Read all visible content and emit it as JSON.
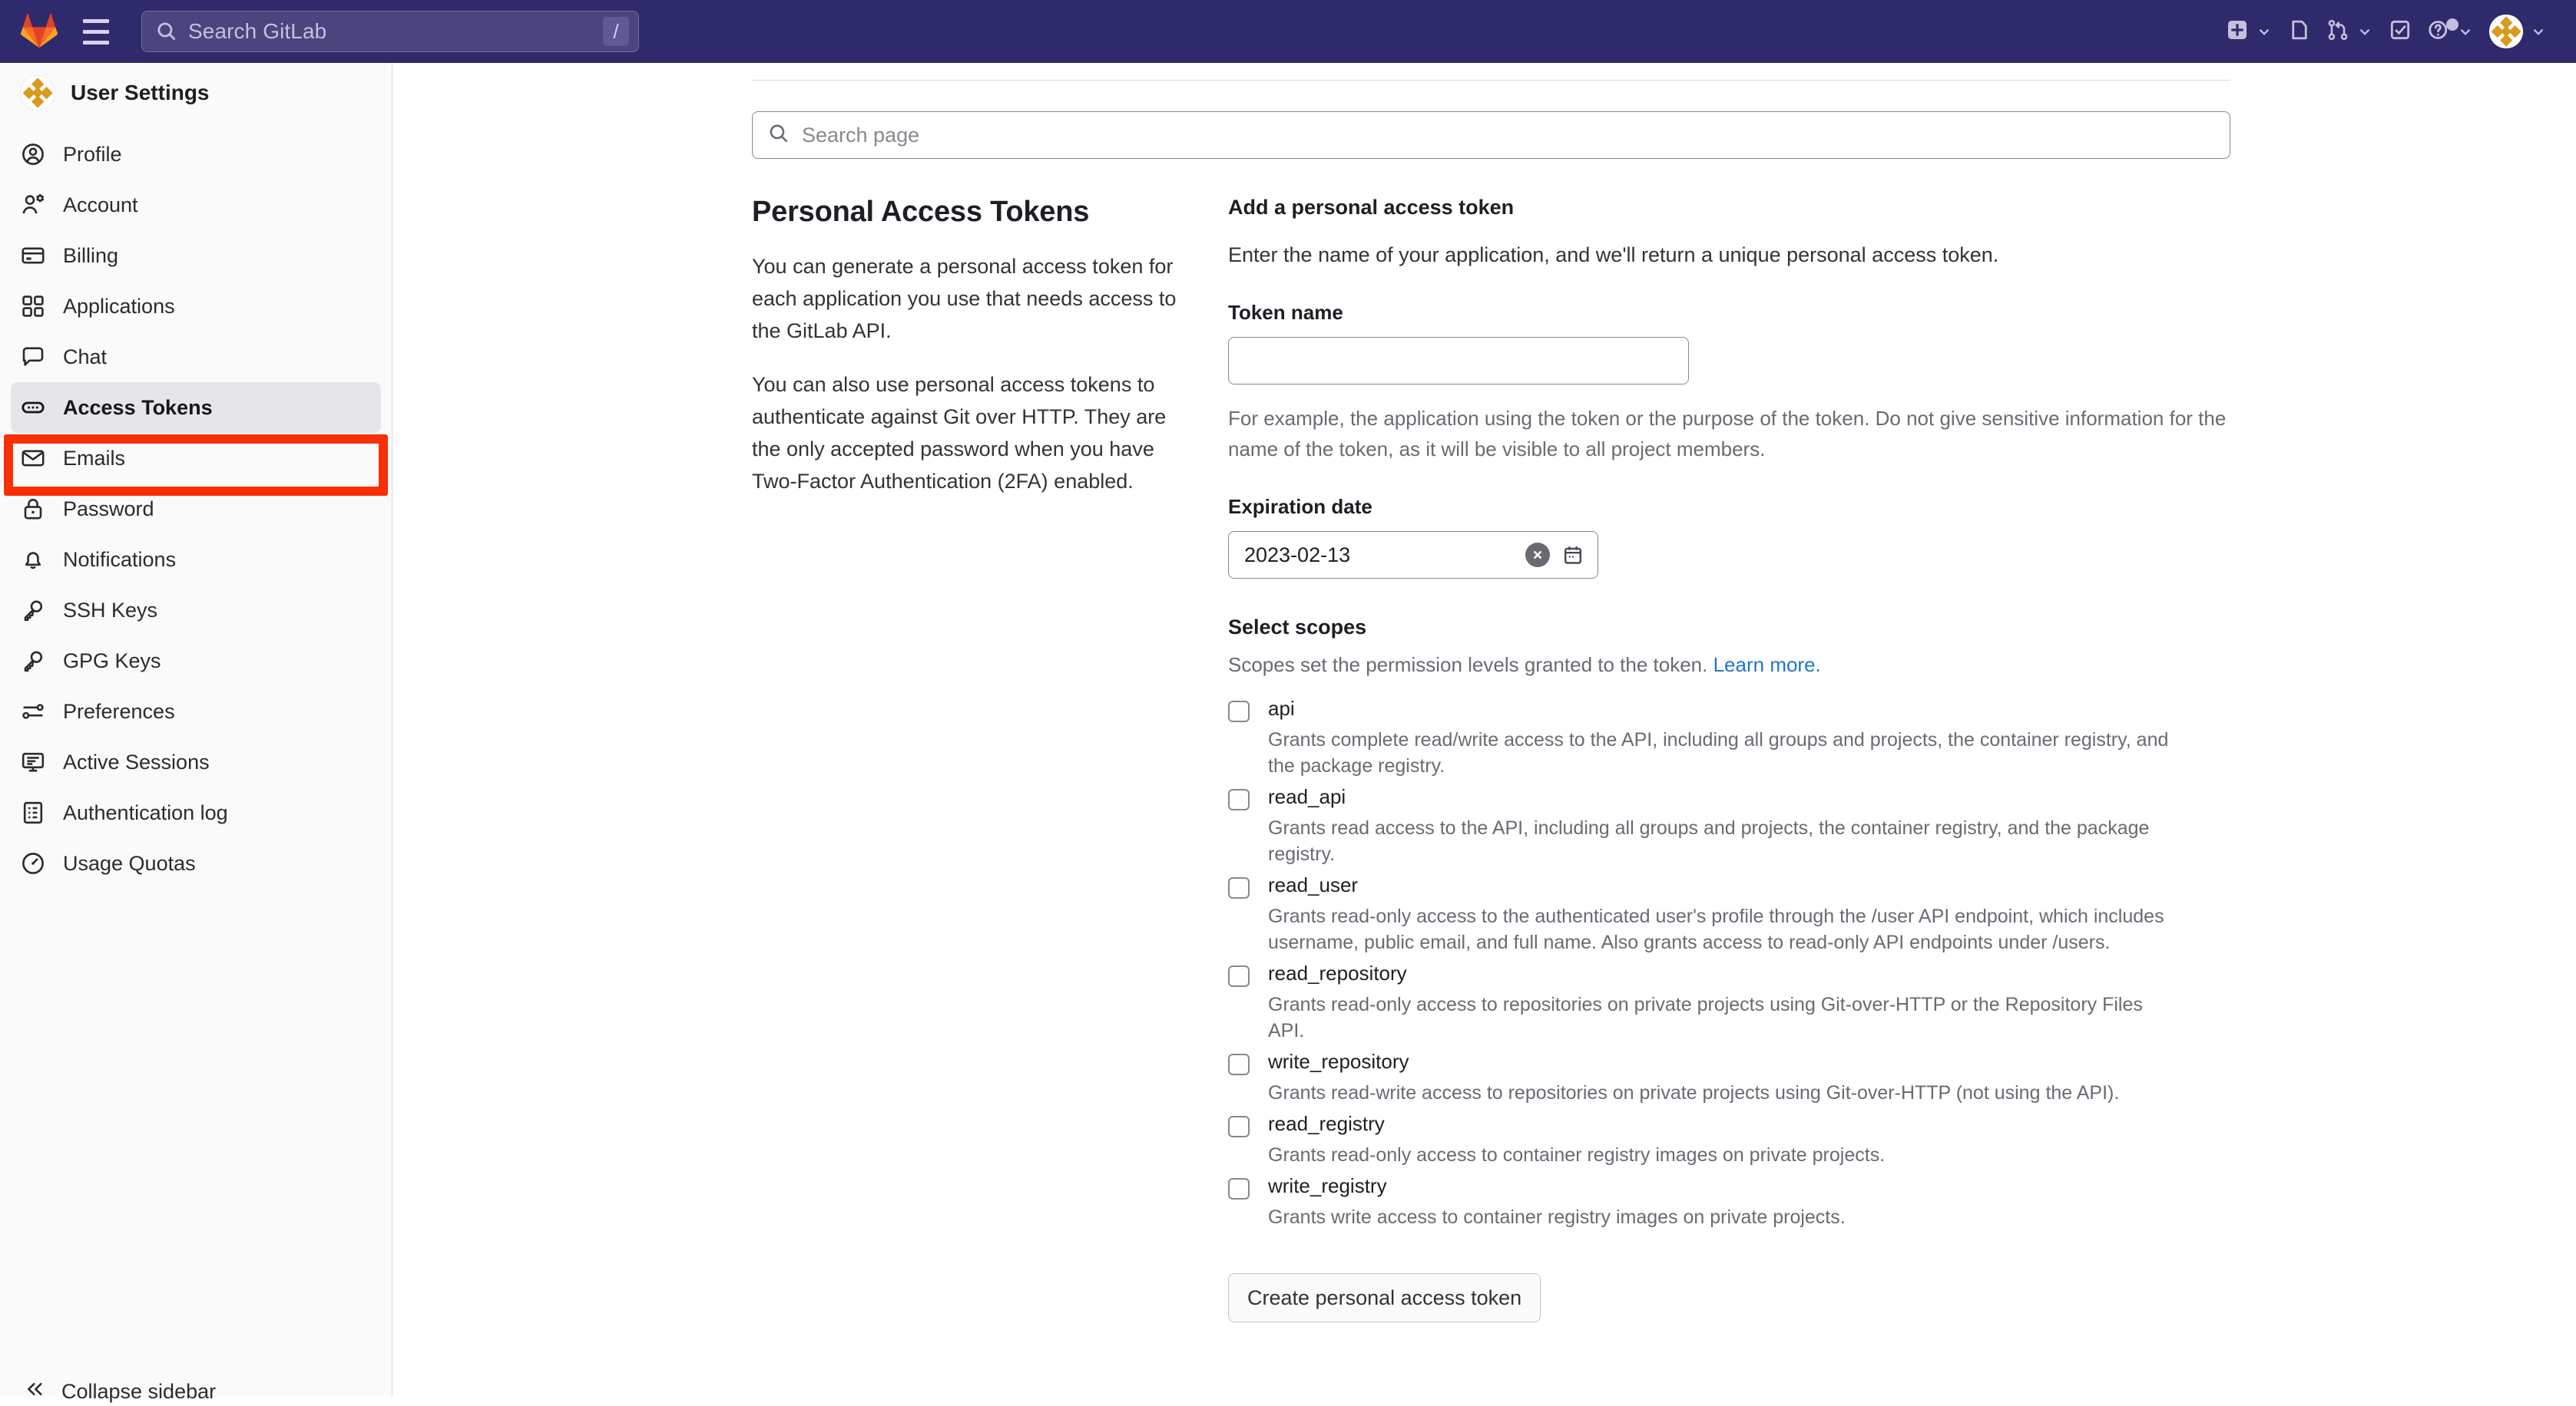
{
  "navbar": {
    "logo": "gitlab-logo-icon",
    "menu_icon": "hamburger-menu-icon",
    "search_placeholder": "Search GitLab",
    "search_shortcut": "/",
    "right_items": [
      {
        "name": "create-new-menu",
        "icon": "plus-square-icon",
        "has_caret": true
      },
      {
        "name": "issues-link",
        "icon": "issues-icon",
        "has_caret": false
      },
      {
        "name": "merge-requests-menu",
        "icon": "merge-request-icon",
        "has_caret": true
      },
      {
        "name": "todos-link",
        "icon": "todo-checkbox-icon",
        "has_caret": false
      },
      {
        "name": "help-menu",
        "icon": "question-circle-icon",
        "has_caret": true
      },
      {
        "name": "user-menu",
        "icon": "user-avatar-icon",
        "has_caret": true
      }
    ]
  },
  "sidebar": {
    "title": "User Settings",
    "avatar": "user-avatar-icon",
    "items": [
      {
        "label": "Profile",
        "icon": "user-circle-icon",
        "active": false
      },
      {
        "label": "Account",
        "icon": "account-gear-icon",
        "active": false
      },
      {
        "label": "Billing",
        "icon": "credit-card-icon",
        "active": false
      },
      {
        "label": "Applications",
        "icon": "applications-grid-icon",
        "active": false
      },
      {
        "label": "Chat",
        "icon": "chat-bubble-icon",
        "active": false
      },
      {
        "label": "Access Tokens",
        "icon": "token-pill-icon",
        "active": true
      },
      {
        "label": "Emails",
        "icon": "envelope-icon",
        "active": false
      },
      {
        "label": "Password",
        "icon": "lock-icon",
        "active": false
      },
      {
        "label": "Notifications",
        "icon": "bell-icon",
        "active": false
      },
      {
        "label": "SSH Keys",
        "icon": "key-icon",
        "active": false
      },
      {
        "label": "GPG Keys",
        "icon": "key-icon",
        "active": false
      },
      {
        "label": "Preferences",
        "icon": "sliders-icon",
        "active": false
      },
      {
        "label": "Active Sessions",
        "icon": "monitor-icon",
        "active": false
      },
      {
        "label": "Authentication log",
        "icon": "log-list-icon",
        "active": false
      },
      {
        "label": "Usage Quotas",
        "icon": "gauge-icon",
        "active": false
      }
    ],
    "collapse_label": "Collapse sidebar",
    "collapse_icon": "chevron-double-left-icon",
    "highlight_color": "#f92f06"
  },
  "page_search": {
    "placeholder": "Search page",
    "icon": "search-icon"
  },
  "left_column": {
    "title": "Personal Access Tokens",
    "paragraph_1": "You can generate a personal access token for each application you use that needs access to the GitLab API.",
    "paragraph_2": "You can also use personal access tokens to authenticate against Git over HTTP. They are the only accepted password when you have Two-Factor Authentication (2FA) enabled."
  },
  "form": {
    "heading": "Add a personal access token",
    "subheading": "Enter the name of your application, and we'll return a unique personal access token.",
    "token_name_label": "Token name",
    "token_name_value": "",
    "token_name_helper": "For example, the application using the token or the purpose of the token. Do not give sensitive information for the name of the token, as it will be visible to all project members.",
    "expiration_label": "Expiration date",
    "expiration_value": "2023-02-13",
    "clear_icon": "clear-x-circle-icon",
    "calendar_icon": "calendar-icon",
    "scopes_heading": "Select scopes",
    "scopes_sub_text": "Scopes set the permission levels granted to the token. ",
    "scopes_link_text": "Learn more.",
    "link_color": "#1f75cb",
    "scopes": [
      {
        "name": "api",
        "checked": false,
        "description": "Grants complete read/write access to the API, including all groups and projects, the container registry, and the package registry."
      },
      {
        "name": "read_api",
        "checked": false,
        "description": "Grants read access to the API, including all groups and projects, the container registry, and the package registry."
      },
      {
        "name": "read_user",
        "checked": false,
        "description": "Grants read-only access to the authenticated user's profile through the /user API endpoint, which includes username, public email, and full name. Also grants access to read-only API endpoints under /users."
      },
      {
        "name": "read_repository",
        "checked": false,
        "description": "Grants read-only access to repositories on private projects using Git-over-HTTP or the Repository Files API."
      },
      {
        "name": "write_repository",
        "checked": false,
        "description": "Grants read-write access to repositories on private projects using Git-over-HTTP (not using the API)."
      },
      {
        "name": "read_registry",
        "checked": false,
        "description": "Grants read-only access to container registry images on private projects."
      },
      {
        "name": "write_registry",
        "checked": false,
        "description": "Grants write access to container registry images on private projects."
      }
    ],
    "submit_label": "Create personal access token"
  }
}
